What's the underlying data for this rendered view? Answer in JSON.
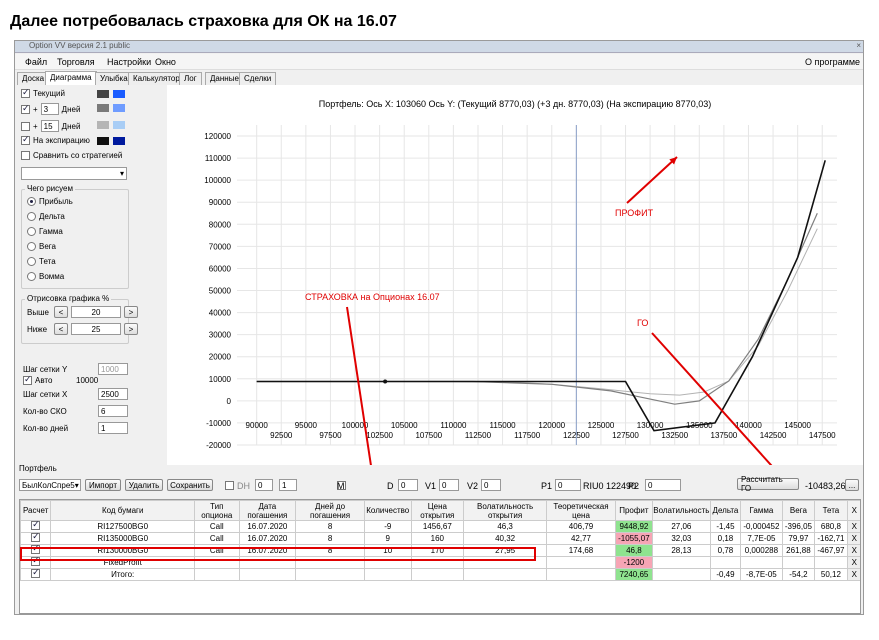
{
  "post_title": "Далее потребовалась страховка для ОК на 16.07",
  "window": {
    "title": "Option VV версия 2.1 public",
    "close_icon": "×"
  },
  "menu": {
    "items": [
      "Файл",
      "Торговля",
      "Настройки",
      "Окно"
    ],
    "about": "О программе"
  },
  "tabs": [
    "Доска",
    "Диаграмма",
    "Улыбка",
    "Калькулятор",
    "Лог",
    "Данные",
    "Сделки"
  ],
  "active_tab": 1,
  "left": {
    "current_label": "Текущий",
    "plus1_sign": "+",
    "plus1_value": "3",
    "plus1_unit": "Дней",
    "plus2_sign": "+",
    "plus2_value": "15",
    "plus2_unit": "Дней",
    "expiry_label": "На экспирацию",
    "compare_label": "Сравнить со стратегией",
    "what_group": "Чего рисуем",
    "what_items": [
      "Прибыль",
      "Дельта",
      "Гамма",
      "Вега",
      "Тета",
      "Вомма"
    ],
    "render_group": "Отрисовка графика %",
    "above_label": "Выше",
    "above_value": "20",
    "below_label": "Ниже",
    "below_value": "25",
    "prev": "<",
    "next": ">",
    "grid_y_label": "Шаг сетки Y",
    "grid_y_value": "1000",
    "auto_label": "Авто",
    "auto_value": "10000",
    "grid_x_label": "Шаг сетки X",
    "grid_x_value": "2500",
    "cko_label": "Кол-во СКО",
    "cko_value": "6",
    "days_label": "Кол-во дней",
    "days_value": "1"
  },
  "colors": {
    "current_dark": "#444444",
    "current_light": "#1a5cff",
    "p3_dark": "#7a7a7a",
    "p3_light": "#6f9cff",
    "p15_dark": "#b5b5b5",
    "p15_light": "#a8cdf5",
    "expiry_dark": "#111111",
    "expiry_light": "#001a9e",
    "accent_red": "#e00000",
    "profit_green": "#8fe38f",
    "loss_pink": "#f7a5b5"
  },
  "chart_data": {
    "type": "line",
    "title": "Портфель: Ось X: 103060 Ось Y:  (Текущий 8770,03)  (+3 дн. 8770,03)  (На экспирацию 8770,03)",
    "x_ticks_top": [
      90000,
      95000,
      100000,
      105000,
      110000,
      115000,
      120000,
      125000,
      130000,
      135000,
      140000,
      145000
    ],
    "x_ticks_bottom": [
      92500,
      97500,
      102500,
      107500,
      112500,
      117500,
      122500,
      127500,
      132500,
      137500,
      142500,
      147500
    ],
    "y_ticks": [
      120000,
      110000,
      100000,
      90000,
      80000,
      70000,
      60000,
      50000,
      40000,
      30000,
      20000,
      10000,
      0,
      -10000,
      -20000
    ],
    "xlim": [
      88000,
      149000
    ],
    "ylim": [
      -20000,
      125000
    ],
    "current_price": 122500,
    "series": [
      {
        "values": [
          [
            90000,
            8770
          ],
          [
            100000,
            8770
          ],
          [
            110000,
            8770
          ],
          [
            116000,
            8500
          ],
          [
            120000,
            7500
          ],
          [
            125000,
            5500
          ],
          [
            130000,
            3200
          ],
          [
            133000,
            2600
          ],
          [
            135500,
            4000
          ],
          [
            138000,
            9000
          ],
          [
            141000,
            25000
          ],
          [
            144000,
            50000
          ],
          [
            147000,
            78000
          ]
        ]
      },
      {
        "values": [
          [
            90000,
            8770
          ],
          [
            112000,
            8770
          ],
          [
            120000,
            7500
          ],
          [
            126000,
            4500
          ],
          [
            130000,
            800
          ],
          [
            132500,
            -1500
          ],
          [
            135000,
            0
          ],
          [
            138000,
            9000
          ],
          [
            141000,
            28000
          ],
          [
            144000,
            55000
          ],
          [
            147000,
            85000
          ]
        ]
      },
      {
        "values": [
          [
            90000,
            8770
          ],
          [
            127500,
            8770
          ],
          [
            130400,
            -13500
          ],
          [
            136600,
            -10000
          ],
          [
            140400,
            20000
          ],
          [
            145000,
            65000
          ],
          [
            147800,
            109000
          ]
        ]
      }
    ],
    "annotations": {
      "profit": "ПРОФИТ",
      "insurance": "СТРАХОВКА на Опционах 16.07",
      "go": "ГО"
    }
  },
  "portfolio": {
    "label": "Портфель",
    "account": "БылКолСпре5",
    "import": "Импорт",
    "delete": "Удалить",
    "save": "Сохранить",
    "dh": "DH",
    "dh1": "0",
    "dh2": "1",
    "m": "M",
    "d_label": "D",
    "d_val": "0",
    "v1_label": "V1",
    "v1_val": "0",
    "v2_label": "V2",
    "v2_val": "0",
    "p1_label": "P1",
    "p1_val": "0",
    "riu": "RIU0 122490",
    "p2_label": "P2",
    "p2_val": "0",
    "calc_go": "Рассчитать ГО",
    "go_value": "-10483,26 п",
    "more": "..."
  },
  "table": {
    "headers": [
      "Расчет",
      "Код бумаги",
      "Тип опциона",
      "Дата погашения",
      "Дней до погашения",
      "Количество",
      "Цена открытия",
      "Волатильность открытия",
      "Теоретическая цена",
      "Профит",
      "Волатильность",
      "Дельта",
      "Гамма",
      "Вега",
      "Тета",
      "X"
    ],
    "rows": [
      [
        "RI127500BG0",
        "Call",
        "16.07.2020",
        "8",
        "-9",
        "1456,67",
        "46,3",
        "406,79",
        "9448,92",
        "27,06",
        "-1,45",
        "-0,000452",
        "-396,05",
        "680,8",
        "X"
      ],
      [
        "RI135000BG0",
        "Call",
        "16.07.2020",
        "8",
        "9",
        "160",
        "40,32",
        "42,77",
        "-1055,07",
        "32,03",
        "0,18",
        "7,7E-05",
        "79,97",
        "-162,71",
        "X"
      ],
      [
        "RI130000BG0",
        "Call",
        "16.07.2020",
        "8",
        "10",
        "170",
        "27,95",
        "174,68",
        "46,8",
        "28,13",
        "0,78",
        "0,000288",
        "261,88",
        "-467,97",
        "X"
      ]
    ],
    "fixed_label": "FixedProfit",
    "fixed_profit": "-1200",
    "fixed_x": "X",
    "total_label": "Итого:",
    "total_profit": "7240,65",
    "total_delta": "-0,49",
    "total_gamma": "-8,7E-05",
    "total_vega": "-54,2",
    "total_theta": "50,12",
    "total_x": "X"
  }
}
